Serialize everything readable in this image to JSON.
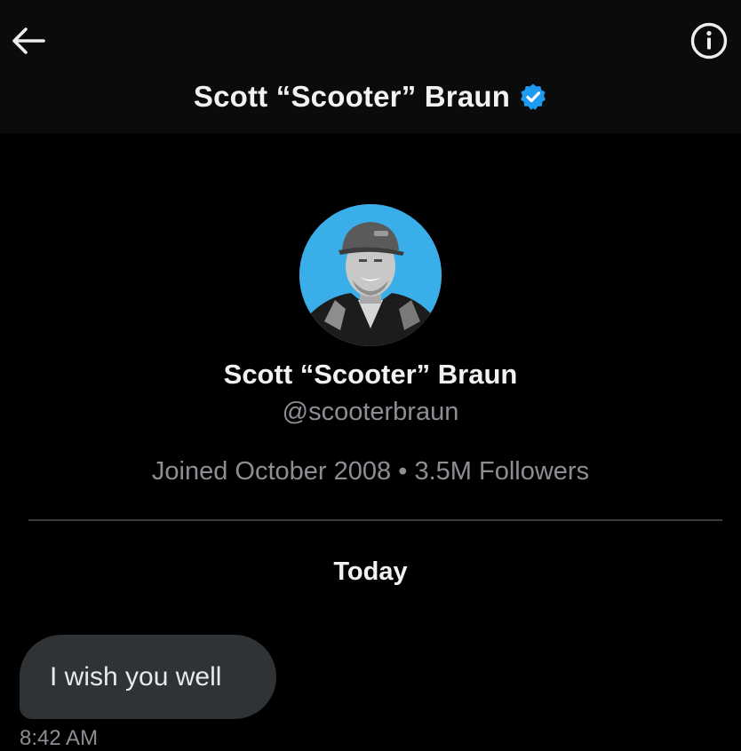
{
  "header": {
    "title": "Scott “Scooter” Braun",
    "back_icon": "arrow-left-icon",
    "info_icon": "info-circle-icon",
    "verified_icon": "verified-badge-icon",
    "verified_color": "#1d9bf0"
  },
  "profile": {
    "name": "Scott “Scooter” Braun",
    "handle": "@scooterbraun",
    "joined": "Joined October 2008",
    "separator": "•",
    "followers": "3.5M Followers",
    "avatar_background": "#3aaee8"
  },
  "conversation": {
    "date_label": "Today",
    "messages": [
      {
        "text": "I wish you well",
        "time": "8:42 AM"
      }
    ]
  }
}
